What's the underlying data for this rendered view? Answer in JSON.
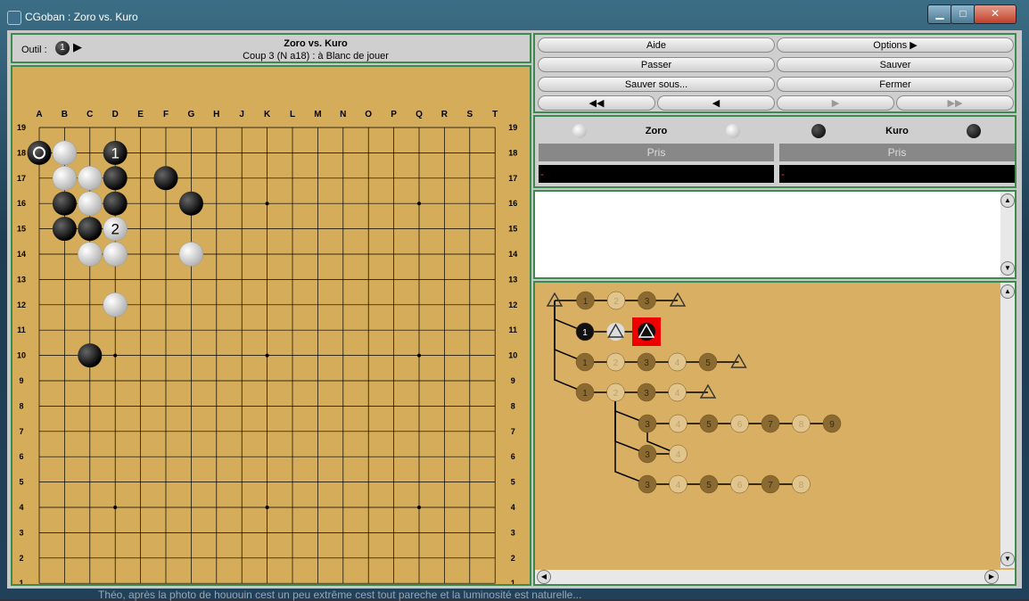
{
  "window": {
    "title": "CGoban : Zoro vs. Kuro"
  },
  "toolbar": {
    "tool_label": "Outil :",
    "tool_stone": "1"
  },
  "game": {
    "title": "Zoro vs. Kuro",
    "status": "Coup 3 (N a18) : à Blanc de jouer"
  },
  "board": {
    "size": 19,
    "columns": [
      "A",
      "B",
      "C",
      "D",
      "E",
      "F",
      "G",
      "H",
      "J",
      "K",
      "L",
      "M",
      "N",
      "O",
      "P",
      "Q",
      "R",
      "S",
      "T"
    ],
    "rows": [
      "19",
      "18",
      "17",
      "16",
      "15",
      "14",
      "13",
      "12",
      "11",
      "10",
      "9",
      "8",
      "7",
      "6",
      "5",
      "4",
      "3",
      "2",
      "1"
    ],
    "black_stones": [
      "A18",
      "D18",
      "D17",
      "F17",
      "B16",
      "D16",
      "G16",
      "B15",
      "C15",
      "C10"
    ],
    "white_stones": [
      "B18",
      "B17",
      "C17",
      "C16",
      "D15",
      "C14",
      "D14",
      "G14",
      "D12"
    ],
    "last_move": "A18",
    "labels": [
      {
        "point": "D18",
        "text": "1"
      },
      {
        "point": "D15",
        "text": "2"
      }
    ]
  },
  "buttons": {
    "help": "Aide",
    "options": "Options",
    "pass": "Passer",
    "save": "Sauver",
    "save_as": "Sauver sous...",
    "close": "Fermer",
    "nav_first": "◀◀",
    "nav_prev": "◀",
    "nav_next": "▶",
    "nav_last": "▶▶"
  },
  "players": {
    "white": {
      "name": "Zoro",
      "captures_label": "Pris",
      "time": "-"
    },
    "black": {
      "name": "Kuro",
      "captures_label": "Pris",
      "time": "-"
    }
  },
  "comment": {
    "text": ""
  },
  "tree": {
    "lines": [
      [
        "root-tri",
        "1",
        "2",
        "3",
        "tri"
      ],
      [
        "1",
        "tri",
        "tri-current"
      ],
      [
        "1",
        "2",
        "3",
        "4",
        "5",
        "tri"
      ],
      [
        "1",
        "2",
        "3",
        "4",
        "tri"
      ],
      [
        "3",
        "4",
        "5",
        "6",
        "7",
        "8",
        "9"
      ],
      [
        "3",
        "4"
      ],
      [
        "3",
        "4",
        "5",
        "6",
        "7",
        "8"
      ]
    ]
  },
  "caption": "Théo, après la photo de hououin cest un peu extrême cest tout pareche et la luminosité est naturelle..."
}
